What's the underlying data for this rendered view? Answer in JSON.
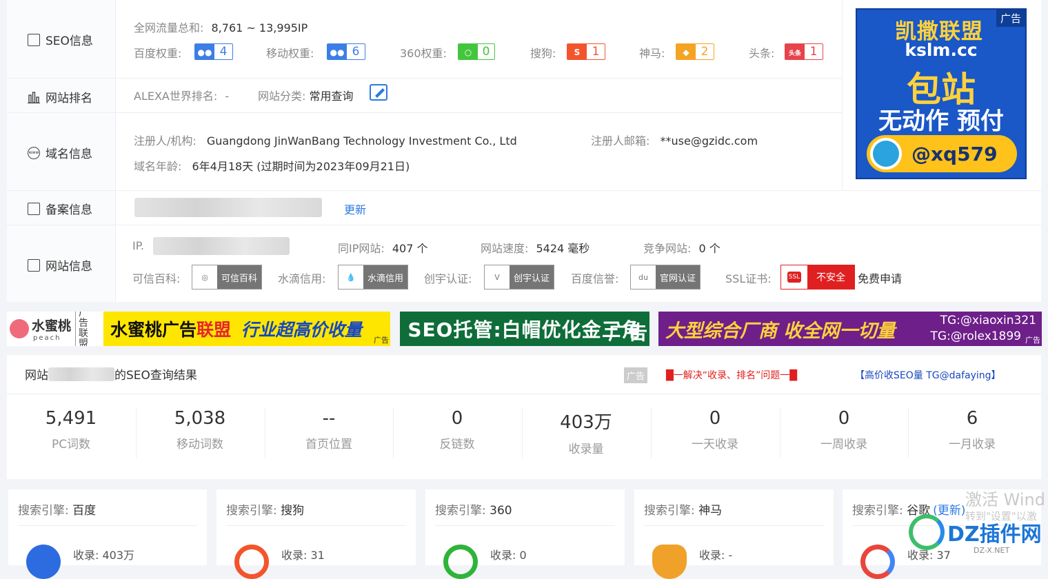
{
  "colors": {
    "baidu": "#3c7ee6",
    "mobile": "#3c7ee6",
    "so360": "#43c63d",
    "sogou": "#f2552c",
    "shenma": "#f5a323",
    "toutiao": "#e7434b",
    "ssl_red": "#e02020",
    "link_blue": "#2a7ae2"
  },
  "seo": {
    "label": "SEO信息",
    "traffic_label": "全网流量总和:",
    "traffic_value": "8,761 ~ 13,995IP",
    "weights": [
      {
        "label": "百度权重:",
        "icon": "baidu-paw-icon",
        "value": "4"
      },
      {
        "label": "移动权重:",
        "icon": "baidu-paw-icon",
        "value": "6"
      },
      {
        "label": "360权重:",
        "icon": "360-icon",
        "value": "0"
      },
      {
        "label": "搜狗:",
        "icon": "sogou-icon",
        "value": "1"
      },
      {
        "label": "神马:",
        "icon": "shenma-icon",
        "value": "2"
      },
      {
        "label": "头条:",
        "icon": "toutiao-icon",
        "value": "1"
      }
    ]
  },
  "rank": {
    "label": "网站排名",
    "alexa_label": "ALEXA世界排名:",
    "alexa_value": "-",
    "category_label": "网站分类:",
    "category_value": "常用查询"
  },
  "domain": {
    "label": "域名信息",
    "registrant_label": "注册人/机构:",
    "registrant_value": "Guangdong JinWanBang Technology Investment Co., Ltd",
    "email_label": "注册人邮箱:",
    "email_value": "**use@gzidc.com",
    "age_label": "域名年龄:",
    "age_value": "6年4月18天 (过期时间为2023年09月21日)"
  },
  "beian": {
    "label": "备案信息",
    "update_link": "更新"
  },
  "site": {
    "label": "网站信息",
    "ip_label": "IP.",
    "same_ip_label": "同IP网站:",
    "same_ip_value": "407 个",
    "speed_label": "网站速度:",
    "speed_value": "5424 毫秒",
    "competitor_label": "竞争网站:",
    "competitor_value": "0 个",
    "certs": [
      {
        "label": "可信百科:",
        "badge": "可信百科"
      },
      {
        "label": "水滴信用:",
        "badge": "水滴信用"
      },
      {
        "label": "创宇认证:",
        "badge": "创宇认证"
      },
      {
        "label": "百度信誉:",
        "badge": "官网认证"
      }
    ],
    "ssl_label": "SSL证书:",
    "ssl_icon_text": "SSL",
    "ssl_status": "不安全",
    "ssl_apply": "免费申请"
  },
  "ad_right": {
    "title": "凯撒联盟",
    "tag": "广告",
    "domain": "kslm.cc",
    "big": "包站",
    "sub": "无动作 预付",
    "handle": "@xq579"
  },
  "banners": {
    "b1_logo": "水蜜桃",
    "b1_logo_sub": "peach",
    "b1_tag": "广告联盟",
    "b1_text_a": "水蜜桃广告",
    "b1_text_b": "联盟",
    "b1_text_c": "行业超高价收量",
    "b1_adtag": "广告",
    "b2_text": "SEO托管:白帽优化金三角",
    "b2_adtag": "广告",
    "b3_text": "大型综合厂商 收全网一切量",
    "b3_side_1": "TG:@xiaoxin321",
    "b3_side_2": "TG:@rolex1899",
    "b3_adtag": "广告"
  },
  "result": {
    "title_prefix": "网站",
    "title_suffix": "的SEO查询结果",
    "ad_tag": "广告",
    "ad_link_1": "█一解决“收录、排名”问题一█",
    "ad_link_2": "【高价收SEO量 TG@dafaying】",
    "stats": [
      {
        "value": "5,491",
        "label": "PC词数"
      },
      {
        "value": "5,038",
        "label": "移动词数"
      },
      {
        "value": "--",
        "label": "首页位置"
      },
      {
        "value": "0",
        "label": "反链数"
      },
      {
        "value": "403万",
        "label": "收录量"
      },
      {
        "value": "0",
        "label": "一天收录"
      },
      {
        "value": "0",
        "label": "一周收录"
      },
      {
        "value": "6",
        "label": "一月收录"
      }
    ]
  },
  "engines": [
    {
      "prefix": "搜索引擎:",
      "name": "百度",
      "icon": "baidu-icon",
      "stat_label": "收录:",
      "stat_value": "403万",
      "extra": ""
    },
    {
      "prefix": "搜索引擎:",
      "name": "搜狗",
      "icon": "sogou-icon",
      "stat_label": "收录:",
      "stat_value": "31",
      "extra": ""
    },
    {
      "prefix": "搜索引擎:",
      "name": "360",
      "icon": "360-icon",
      "stat_label": "收录:",
      "stat_value": "0",
      "extra": ""
    },
    {
      "prefix": "搜索引擎:",
      "name": "神马",
      "icon": "shenma-icon",
      "stat_label": "收录:",
      "stat_value": "-",
      "extra": ""
    },
    {
      "prefix": "搜索引擎:",
      "name": "谷歌",
      "icon": "google-icon",
      "stat_label": "收录:",
      "stat_value": "37",
      "extra": "(更新)"
    }
  ],
  "watermark": {
    "line1": "激活 Wind",
    "line2": "转到\"设置\"以激",
    "brand": "DZ插件网",
    "brand_url": "DZ-X.NET"
  }
}
